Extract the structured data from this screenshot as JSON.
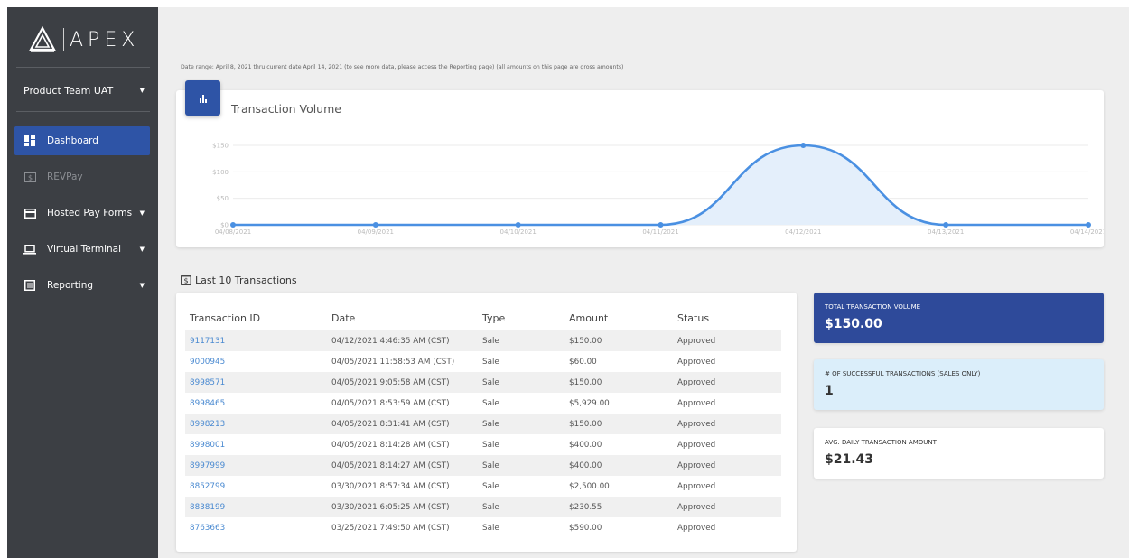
{
  "brand": {
    "name": "APEX"
  },
  "sidebar": {
    "team": "Product Team UAT",
    "items": [
      {
        "label": "Dashboard",
        "icon": "dashboard-icon",
        "active": true
      },
      {
        "label": "REVPay",
        "icon": "revpay-icon"
      },
      {
        "label": "Hosted Pay Forms",
        "icon": "credit-card-icon"
      },
      {
        "label": "Virtual Terminal",
        "icon": "laptop-icon"
      },
      {
        "label": "Reporting",
        "icon": "report-icon"
      }
    ]
  },
  "date_range_note": "Date range: April 8, 2021 thru current date April 14, 2021 (to see more data, please access the Reporting page) (all amounts on this page are gross amounts)",
  "chart": {
    "title": "Transaction Volume"
  },
  "chart_data": {
    "type": "area",
    "title": "Transaction Volume",
    "categories": [
      "04/08/2021",
      "04/09/2021",
      "04/10/2021",
      "04/11/2021",
      "04/12/2021",
      "04/13/2021",
      "04/14/2021"
    ],
    "values": [
      0,
      0,
      0,
      0,
      150,
      0,
      0
    ],
    "y_ticks": [
      "$0",
      "$50",
      "$100",
      "$150"
    ],
    "ylim": [
      0,
      150
    ],
    "grid": true,
    "color": "#4a90e2"
  },
  "transactions": {
    "heading": "Last 10 Transactions",
    "columns": [
      "Transaction ID",
      "Date",
      "Type",
      "Amount",
      "Status"
    ],
    "rows": [
      [
        "9117131",
        "04/12/2021 4:46:35 AM (CST)",
        "Sale",
        "$150.00",
        "Approved"
      ],
      [
        "9000945",
        "04/05/2021 11:58:53 AM (CST)",
        "Sale",
        "$60.00",
        "Approved"
      ],
      [
        "8998571",
        "04/05/2021 9:05:58 AM (CST)",
        "Sale",
        "$150.00",
        "Approved"
      ],
      [
        "8998465",
        "04/05/2021 8:53:59 AM (CST)",
        "Sale",
        "$5,929.00",
        "Approved"
      ],
      [
        "8998213",
        "04/05/2021 8:31:41 AM (CST)",
        "Sale",
        "$150.00",
        "Approved"
      ],
      [
        "8998001",
        "04/05/2021 8:14:28 AM (CST)",
        "Sale",
        "$400.00",
        "Approved"
      ],
      [
        "8997999",
        "04/05/2021 8:14:27 AM (CST)",
        "Sale",
        "$400.00",
        "Approved"
      ],
      [
        "8852799",
        "03/30/2021 8:57:34 AM (CST)",
        "Sale",
        "$2,500.00",
        "Approved"
      ],
      [
        "8838199",
        "03/30/2021 6:05:25 AM (CST)",
        "Sale",
        "$230.55",
        "Approved"
      ],
      [
        "8763663",
        "03/25/2021 7:49:50 AM (CST)",
        "Sale",
        "$590.00",
        "Approved"
      ]
    ]
  },
  "stats": [
    {
      "label": "TOTAL TRANSACTION VOLUME",
      "value": "$150.00"
    },
    {
      "label": "# OF SUCCESSFUL TRANSACTIONS (SALES ONLY)",
      "value": "1"
    },
    {
      "label": "AVG. DAILY TRANSACTION AMOUNT",
      "value": "$21.43"
    }
  ],
  "colors": {
    "sidebar_bg": "#3c3f44",
    "accent": "#2e54a6",
    "link": "#4a8ad1",
    "line": "#4a90e2"
  }
}
